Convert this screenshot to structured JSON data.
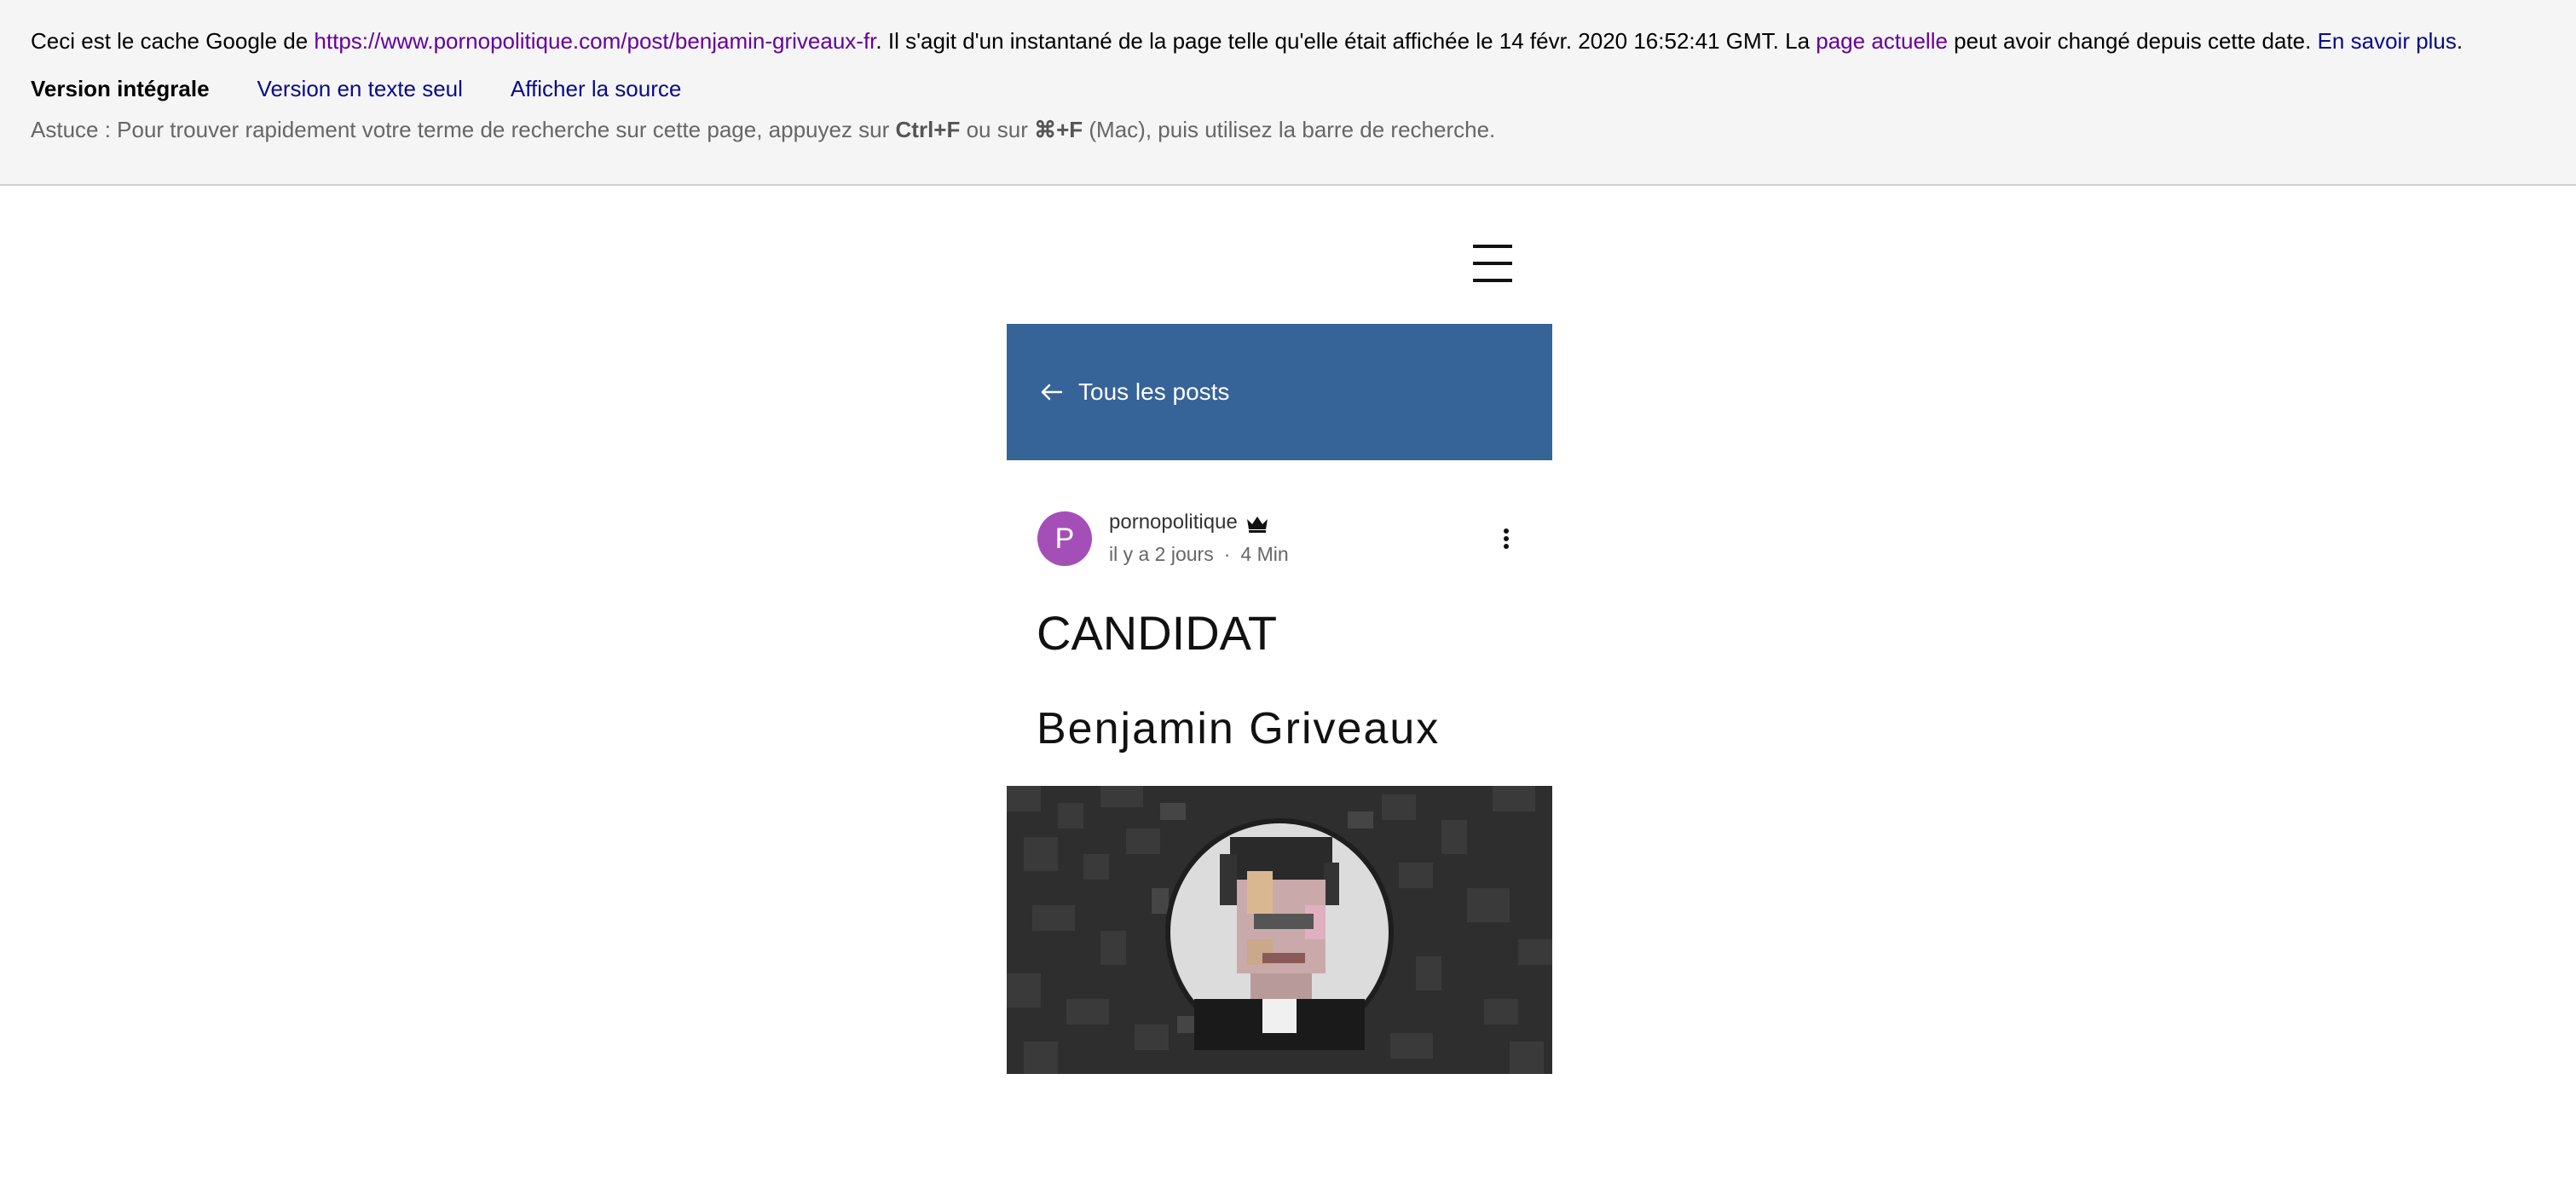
{
  "cache_banner": {
    "prefix": "Ceci est le cache Google de ",
    "cached_url": "https://www.pornopolitique.com/post/benjamin-griveaux-fr",
    "middle": ". Il s'agit d'un instantané de la page telle qu'elle était affichée le 14 févr. 2020 16:52:41 GMT. La ",
    "current_page_link": "page actuelle",
    "suffix": " peut avoir changé depuis cette date. ",
    "learn_more_link": "En savoir plus",
    "learn_more_end": ".",
    "version_full": "Version intégrale",
    "version_text": "Version en texte seul",
    "view_source": "Afficher la source",
    "tip_prefix": "Astuce : Pour trouver rapidement votre terme de recherche sur cette page, appuyez sur ",
    "tip_key1": "Ctrl+F",
    "tip_mid": " ou sur ",
    "tip_key2": "⌘+F",
    "tip_suffix": " (Mac), puis utilisez la barre de recherche."
  },
  "header": {
    "menu_icon": "hamburger-menu-icon"
  },
  "back_banner": {
    "label": "Tous les posts",
    "icon": "arrow-left-icon",
    "color": "#366398"
  },
  "post": {
    "avatar_letter": "P",
    "avatar_color": "#a44fb8",
    "author": "pornopolitique",
    "author_badge_icon": "crown-icon",
    "time_ago": "il y a 2 jours",
    "separator": "·",
    "read_time": "4 Min",
    "more_icon": "more-vertical-icon",
    "title_line1": "CANDIDAT",
    "title_line2": "Benjamin Griveaux"
  }
}
